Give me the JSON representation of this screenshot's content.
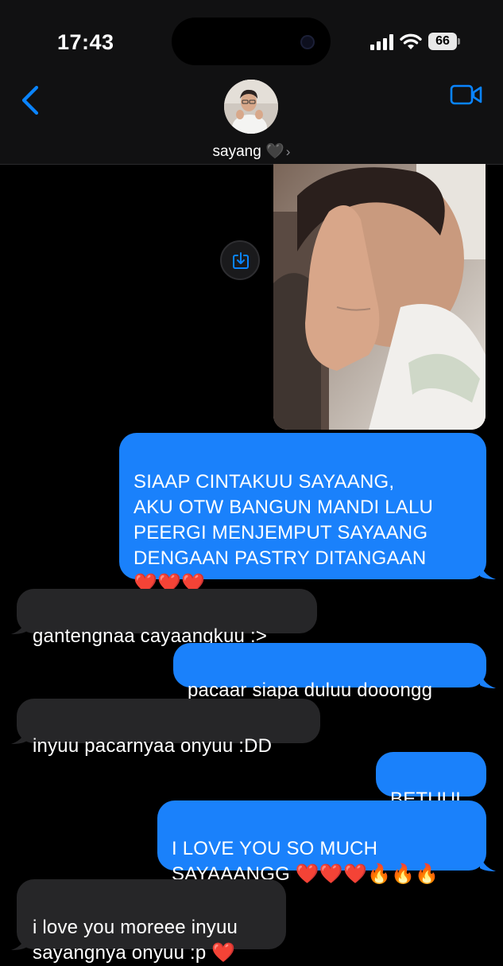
{
  "status": {
    "time": "17:43",
    "battery": "66"
  },
  "header": {
    "contact_name": "sayang 🖤",
    "chevron": "›",
    "back_icon": "chevron-left-icon",
    "video_icon": "video-camera-icon"
  },
  "colors": {
    "sent_bubble": "#1a81fb",
    "received_bubble": "#262628",
    "accent": "#0a84ff",
    "background": "#000000"
  },
  "messages": [
    {
      "from": "me",
      "type": "image",
      "description_icon": "photo"
    },
    {
      "from": "me",
      "text": "SIAAP CINTAKUU SAYAANG,\nAKU OTW BANGUN MANDI LALU\nPEERGI MENJEMPUT SAYAANG\nDENGAAN PASTRY DITANGAAN\n❤️❤️❤️"
    },
    {
      "from": "them",
      "text": "gantengnaa cayaangkuu :>"
    },
    {
      "from": "me",
      "text": "pacaar siapa duluu dooongg"
    },
    {
      "from": "them",
      "text": "inyuu pacarnyaa onyuu :DD"
    },
    {
      "from": "me",
      "text": "BETUUL"
    },
    {
      "from": "me",
      "text": "I LOVE YOU SO MUCH\nSAYAAANGG ❤️❤️❤️🔥🔥🔥"
    },
    {
      "from": "them",
      "text": "i love you moreee inyuu\nsayangnya onyuu :p ❤️"
    }
  ]
}
